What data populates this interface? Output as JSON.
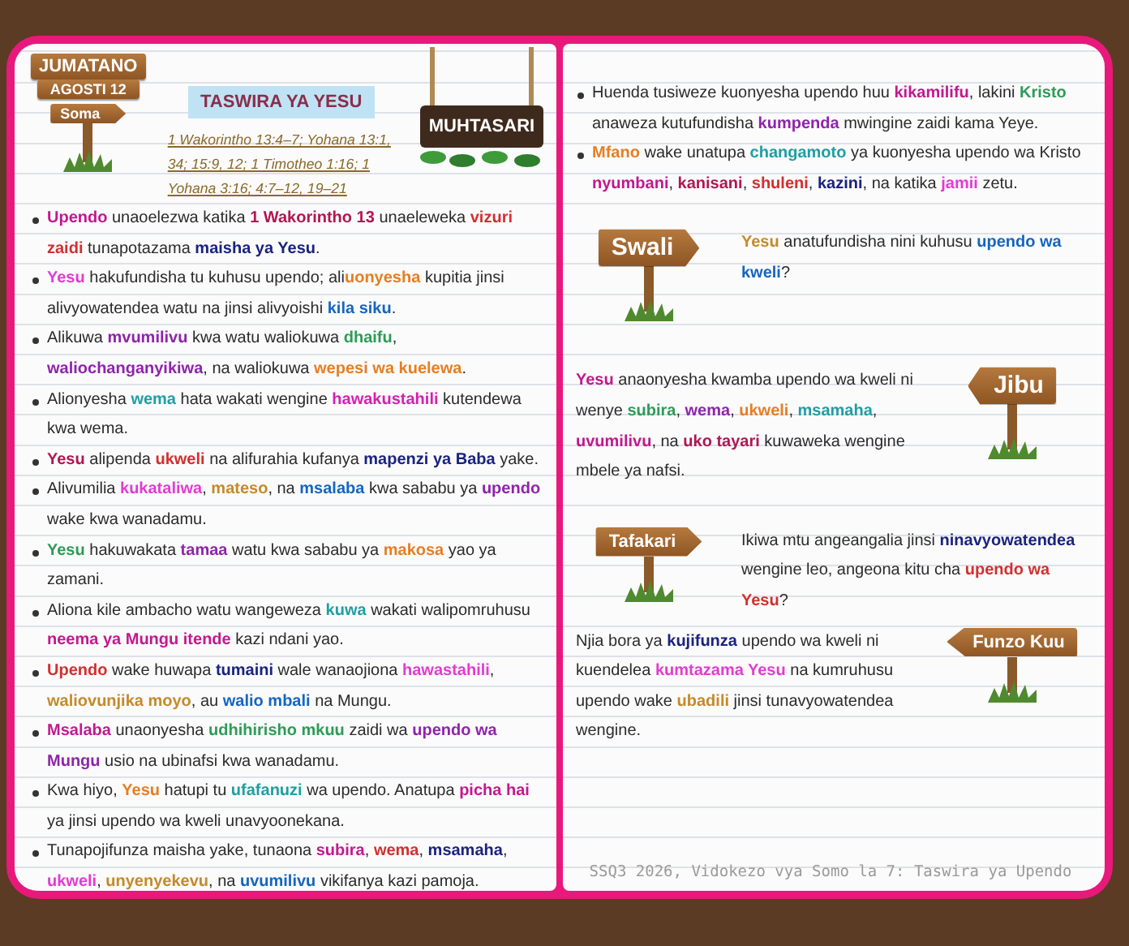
{
  "header": {
    "day": "JUMATANO",
    "date": "AGOSTI 12",
    "read_label": "Soma",
    "readings": "1 Wakorintho 13:4–7; Yohana 13:1, 34; 15:9, 12; 1 Timotheo 1:16; 1 Yohana 3:16; 4:7–12, 19–21",
    "title": "TASWIRA YA YESU",
    "summary_sign": "MUHTASARI"
  },
  "summary_left": [
    [
      {
        "text": "Upendo",
        "color": "#c2188f"
      },
      {
        "text": " unaoelezwa katika "
      },
      {
        "text": "1 Wakorintho 13",
        "color": "#b0174f"
      },
      {
        "text": " unaeleweka "
      },
      {
        "text": "vizuri zaidi",
        "color": "#d32f2f"
      },
      {
        "text": " tunapotazama "
      },
      {
        "text": "maisha ya Yesu",
        "color": "#1a237e"
      },
      {
        "text": "."
      }
    ],
    [
      {
        "text": "Yesu",
        "color": "#e23bd0"
      },
      {
        "text": " hakufundisha tu kuhusu upendo; ali"
      },
      {
        "text": "uonyesha",
        "color": "#e67e22"
      },
      {
        "text": " kupitia jinsi alivyowatendea watu na jinsi alivyoishi "
      },
      {
        "text": "kila siku",
        "color": "#1565c0"
      },
      {
        "text": "."
      }
    ],
    [
      {
        "text": "Alikuwa "
      },
      {
        "text": "mvumilivu",
        "color": "#8e24aa"
      },
      {
        "text": " kwa watu waliokuwa "
      },
      {
        "text": "dhaifu",
        "color": "#2e9b57"
      },
      {
        "text": ", "
      },
      {
        "text": "waliochanganyikiwa",
        "color": "#8e24aa"
      },
      {
        "text": ", na waliokuwa "
      },
      {
        "text": "wepesi wa kuelewa",
        "color": "#e67e22"
      },
      {
        "text": "."
      }
    ],
    [
      {
        "text": "Alionyesha "
      },
      {
        "text": "wema",
        "color": "#1f9ea3"
      },
      {
        "text": " hata wakati wengine "
      },
      {
        "text": "hawakustahili",
        "color": "#d61fb0"
      },
      {
        "text": " kutendewa kwa wema."
      }
    ],
    [
      {
        "text": "Yesu",
        "color": "#b0174f"
      },
      {
        "text": " alipenda "
      },
      {
        "text": "ukweli",
        "color": "#d32f2f"
      },
      {
        "text": " na alifurahia kufanya "
      },
      {
        "text": "mapenzi ya Baba",
        "color": "#1a237e"
      },
      {
        "text": " yake."
      }
    ],
    [
      {
        "text": "Alivumilia "
      },
      {
        "text": "kukataliwa",
        "color": "#e23bd0"
      },
      {
        "text": ", "
      },
      {
        "text": "mateso",
        "color": "#c48a2a"
      },
      {
        "text": ", na "
      },
      {
        "text": "msalaba",
        "color": "#1565c0"
      },
      {
        "text": " kwa sababu ya "
      },
      {
        "text": "upendo",
        "color": "#8e24aa"
      },
      {
        "text": " wake kwa wanadamu."
      }
    ],
    [
      {
        "text": "Yesu",
        "color": "#2e9b57"
      },
      {
        "text": " hakuwakata "
      },
      {
        "text": "tamaa",
        "color": "#8e24aa"
      },
      {
        "text": " watu kwa sababu ya "
      },
      {
        "text": "makosa",
        "color": "#e67e22"
      },
      {
        "text": " yao ya zamani."
      }
    ],
    [
      {
        "text": "Aliona kile ambacho watu wangeweza "
      },
      {
        "text": "kuwa",
        "color": "#1f9ea3"
      },
      {
        "text": " wakati walipomruhusu "
      },
      {
        "text": "neema ya Mungu itende",
        "color": "#c2188f"
      },
      {
        "text": " kazi ndani yao."
      }
    ],
    [
      {
        "text": "Upendo",
        "color": "#d32f2f"
      },
      {
        "text": " wake huwapa "
      },
      {
        "text": "tumaini",
        "color": "#1a237e"
      },
      {
        "text": " wale wanaojiona "
      },
      {
        "text": "hawastahili",
        "color": "#e23bd0"
      },
      {
        "text": ", "
      },
      {
        "text": "waliovunjika moyo",
        "color": "#c48a2a"
      },
      {
        "text": ", au "
      },
      {
        "text": "walio mbali",
        "color": "#1565c0"
      },
      {
        "text": " na Mungu."
      }
    ],
    [
      {
        "text": "Msalaba",
        "color": "#c2188f"
      },
      {
        "text": " unaonyesha "
      },
      {
        "text": "udhihirisho mkuu",
        "color": "#2e9b57"
      },
      {
        "text": " zaidi wa "
      },
      {
        "text": "upendo wa Mungu",
        "color": "#8e24aa"
      },
      {
        "text": " usio na ubinafsi kwa wanadamu."
      }
    ],
    [
      {
        "text": "Kwa hiyo, "
      },
      {
        "text": "Yesu",
        "color": "#e67e22"
      },
      {
        "text": " hatupi tu "
      },
      {
        "text": "ufafanuzi",
        "color": "#1f9ea3"
      },
      {
        "text": " wa upendo. Anatupa "
      },
      {
        "text": "picha hai",
        "color": "#c2188f"
      },
      {
        "text": " ya jinsi upendo wa kweli unavyoonekana."
      }
    ],
    [
      {
        "text": "Tunapojifunza maisha yake, tunaona "
      },
      {
        "text": "subira",
        "color": "#c2188f"
      },
      {
        "text": ", "
      },
      {
        "text": "wema",
        "color": "#d32f2f"
      },
      {
        "text": ", "
      },
      {
        "text": "msamaha",
        "color": "#1a237e"
      },
      {
        "text": ", "
      },
      {
        "text": "ukweli",
        "color": "#e23bd0"
      },
      {
        "text": ", "
      },
      {
        "text": "unyenyekevu",
        "color": "#c48a2a"
      },
      {
        "text": ", na "
      },
      {
        "text": "uvumilivu",
        "color": "#1565c0"
      },
      {
        "text": " vikifanya kazi pamoja."
      }
    ]
  ],
  "summary_right": [
    [
      {
        "text": "Huenda tusiweze kuonyesha upendo huu "
      },
      {
        "text": "kikamilifu",
        "color": "#c2188f"
      },
      {
        "text": ", lakini "
      },
      {
        "text": "Kristo",
        "color": "#2e9b57"
      },
      {
        "text": " anaweza kutufundisha "
      },
      {
        "text": "kumpenda",
        "color": "#8e24aa"
      },
      {
        "text": " mwingine zaidi kama Yeye."
      }
    ],
    [
      {
        "text": "Mfano",
        "color": "#e67e22"
      },
      {
        "text": " wake unatupa "
      },
      {
        "text": "changamoto",
        "color": "#1f9ea3"
      },
      {
        "text": " ya kuonyesha upendo wa Kristo "
      },
      {
        "text": "nyumbani",
        "color": "#c2188f"
      },
      {
        "text": ", "
      },
      {
        "text": "kanisani",
        "color": "#b0174f"
      },
      {
        "text": ", "
      },
      {
        "text": "shuleni",
        "color": "#d32f2f"
      },
      {
        "text": ", "
      },
      {
        "text": "kazini",
        "color": "#1a237e"
      },
      {
        "text": ", na katika "
      },
      {
        "text": "jamii",
        "color": "#e23bd0"
      },
      {
        "text": " zetu."
      }
    ]
  ],
  "prompts": [
    {
      "kind": "question",
      "sign": "Swali",
      "text": [
        {
          "text": "Yesu",
          "color": "#c48a2a"
        },
        {
          "text": " anatufundisha nini kuhusu "
        },
        {
          "text": "upendo wa kweli",
          "color": "#1565c0"
        },
        {
          "text": "?"
        }
      ]
    },
    {
      "kind": "answer",
      "sign": "Jibu",
      "text": [
        {
          "text": "Yesu",
          "color": "#c2188f"
        },
        {
          "text": " anaonyesha kwamba upendo wa kweli ni wenye "
        },
        {
          "text": "subira",
          "color": "#2e9b57"
        },
        {
          "text": ", "
        },
        {
          "text": "wema",
          "color": "#8e24aa"
        },
        {
          "text": ", "
        },
        {
          "text": "ukweli",
          "color": "#e67e22"
        },
        {
          "text": ", "
        },
        {
          "text": "msamaha",
          "color": "#1f9ea3"
        },
        {
          "text": ", "
        },
        {
          "text": "uvumilivu",
          "color": "#c2188f"
        },
        {
          "text": ", na "
        },
        {
          "text": "uko tayari",
          "color": "#b0174f"
        },
        {
          "text": " kuwaweka wengine mbele ya nafsi."
        }
      ]
    },
    {
      "kind": "reflection",
      "sign": "Tafakari",
      "text": [
        {
          "text": "Ikiwa mtu angeangalia jinsi "
        },
        {
          "text": "ninavyowatendea",
          "color": "#1a237e"
        },
        {
          "text": " wengine leo, angeona kitu cha "
        },
        {
          "text": "upendo wa Yesu",
          "color": "#d32f2f"
        },
        {
          "text": "?"
        }
      ]
    },
    {
      "kind": "lesson",
      "sign": "Funzo Kuu",
      "text": [
        {
          "text": "Njia bora ya "
        },
        {
          "text": "kujifunza",
          "color": "#1a237e"
        },
        {
          "text": " upendo wa kweli ni kuendelea "
        },
        {
          "text": "kumtazama Yesu",
          "color": "#e23bd0"
        },
        {
          "text": " na kumruhusu upendo wake "
        },
        {
          "text": "ubadili",
          "color": "#c48a2a"
        },
        {
          "text": " jinsi tunavyowatendea wengine."
        }
      ]
    }
  ],
  "footer": "SSQ3 2026, Vidokezo vya Somo la 7: Taswira ya Upendo"
}
